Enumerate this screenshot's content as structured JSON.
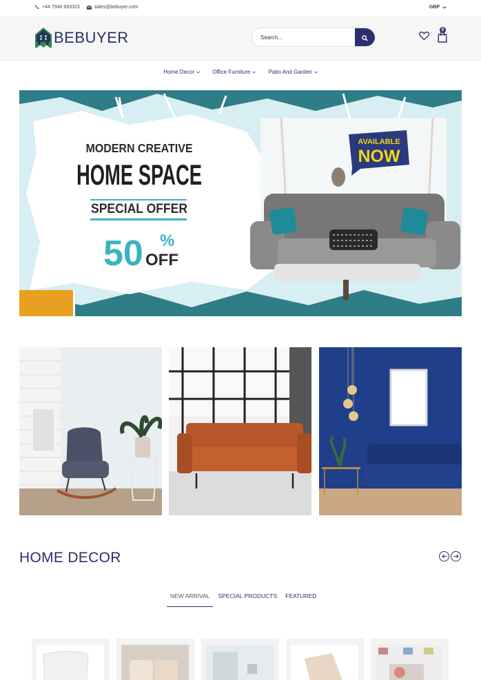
{
  "topbar": {
    "phone": "+44 7940 933323",
    "email": "sales@bebuyer.com",
    "currency": "GBP"
  },
  "header": {
    "logo_text": "BEBUYER",
    "search_placeholder": "Search...",
    "cart_count": "0"
  },
  "nav": {
    "items": [
      {
        "label": "Home Decor"
      },
      {
        "label": "Office Furniture"
      },
      {
        "label": "Patio And Garden"
      }
    ]
  },
  "hero": {
    "line1": "MODERN CREATIVE",
    "line2": "HOME SPACE",
    "line3": "SPECIAL OFFER",
    "percent": "50",
    "percent_sign": "%",
    "off": "OFF",
    "badge_line1": "AVAILABLE",
    "badge_line2": "NOW"
  },
  "section": {
    "title": "HOME DECOR",
    "tabs": [
      {
        "label": "NEW ARRIVAL",
        "active": true
      },
      {
        "label": "SPECIAL PRODUCTS",
        "active": false
      },
      {
        "label": "FEATURED",
        "active": false
      }
    ]
  },
  "colors": {
    "brand": "#2b2f6b",
    "hero_teal": "#2e7d87",
    "accent_cyan": "#38b4c4",
    "badge_yellow": "#f2d61b"
  }
}
